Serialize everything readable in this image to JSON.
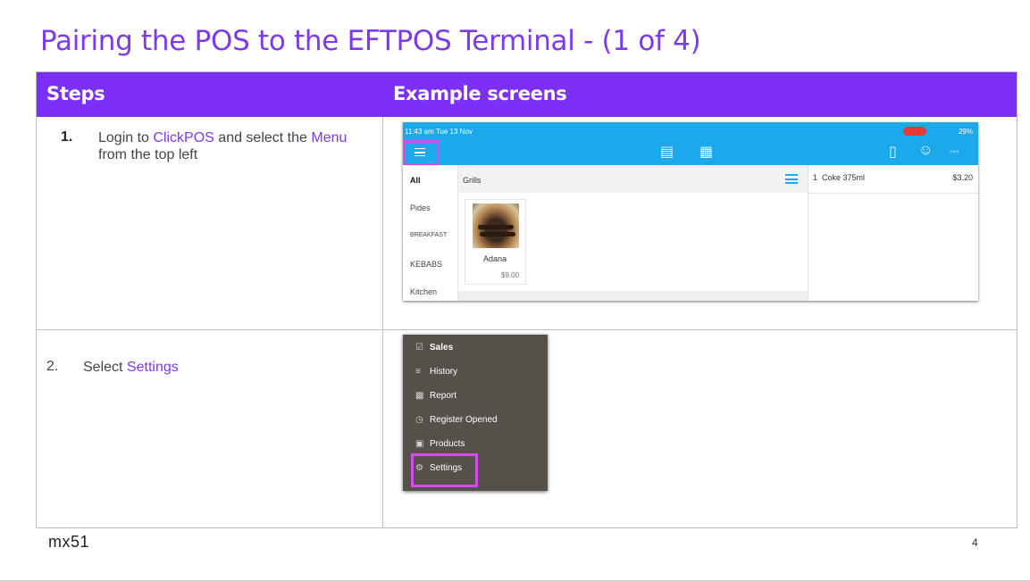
{
  "slide": {
    "title": "Pairing the POS to the EFTPOS Terminal - (1 of 4)",
    "page_number": "4",
    "logo_text": "mx51",
    "accent_color": "#7b2ff7"
  },
  "table": {
    "headers": {
      "steps": "Steps",
      "examples": "Example screens"
    },
    "step1": {
      "number": "1.",
      "text_a": "Login to ",
      "highlight_a": "ClickPOS",
      "text_b": " and select the ",
      "highlight_b": "Menu",
      "line2": "from the top left"
    },
    "step2": {
      "number": "2.",
      "text_a": "Select ",
      "highlight_a": "Settings"
    }
  },
  "pos_screen": {
    "status_left": "11:43 am  Tue 13 Nov",
    "status_right": "29%",
    "categories": [
      "All",
      "Pides",
      "BREAKFAST",
      "KEBABS",
      "Kitchen"
    ],
    "grid_title": "Grills",
    "product": {
      "name": "Adana",
      "price": "$9.00"
    },
    "order": {
      "qty": "1",
      "item": "Coke 375ml",
      "price": "$3.20"
    },
    "icons": [
      "menu-icon",
      "receipt-search-icon",
      "register-icon",
      "clipboard-icon",
      "user-icon",
      "more-icon",
      "list-view-icon"
    ]
  },
  "menu_screen": {
    "items": [
      {
        "label": "Sales",
        "icon": "cart-icon"
      },
      {
        "label": "History",
        "icon": "list-icon"
      },
      {
        "label": "Report",
        "icon": "chart-icon"
      },
      {
        "label": "Register Opened",
        "icon": "clock-icon"
      },
      {
        "label": "Products",
        "icon": "box-icon"
      },
      {
        "label": "Settings",
        "icon": "gear-icon"
      }
    ],
    "highlight_color": "#d54bf0"
  }
}
